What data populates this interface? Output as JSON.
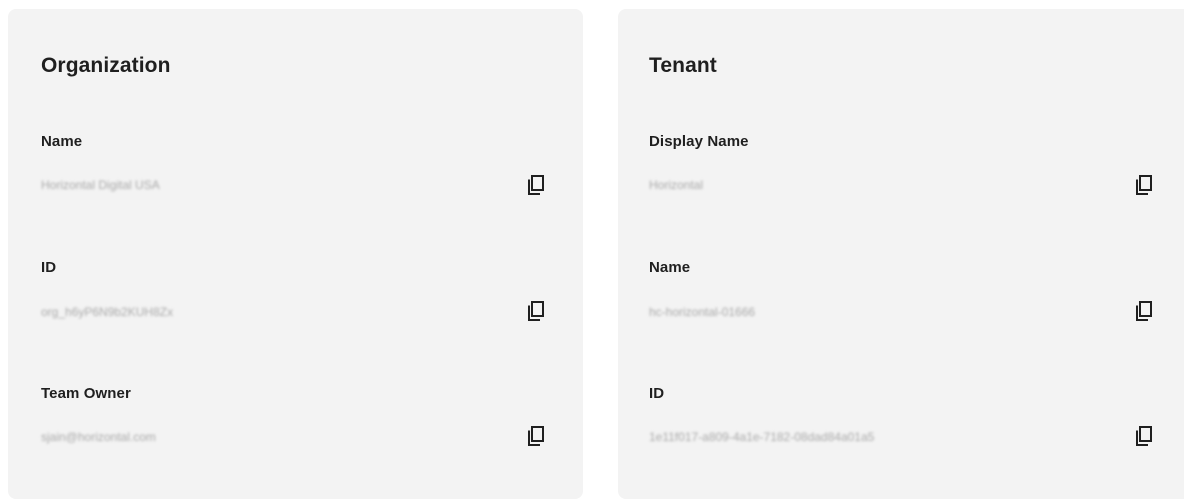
{
  "organization": {
    "title": "Organization",
    "fields": [
      {
        "label": "Name",
        "value": "Horizontal Digital USA",
        "copy_icon": "copy-icon"
      },
      {
        "label": "ID",
        "value": "org_h6yP6N9b2KUH8Zx",
        "copy_icon": "copy-icon"
      },
      {
        "label": "Team Owner",
        "value": "sjain@horizontal.com",
        "copy_icon": "copy-icon"
      }
    ]
  },
  "tenant": {
    "title": "Tenant",
    "fields": [
      {
        "label": "Display Name",
        "value": "Horizontal",
        "copy_icon": "copy-icon"
      },
      {
        "label": "Name",
        "value": "hc-horizontal-01666",
        "copy_icon": "copy-icon"
      },
      {
        "label": "ID",
        "value": "1e11f017-a809-4a1e-7182-08dad84a01a5",
        "copy_icon": "copy-icon"
      }
    ]
  },
  "colors": {
    "card_background": "#f3f3f3",
    "label_text": "#1f1f1f",
    "value_text": "#a9a9a9",
    "icon": "#1f1f1f"
  }
}
